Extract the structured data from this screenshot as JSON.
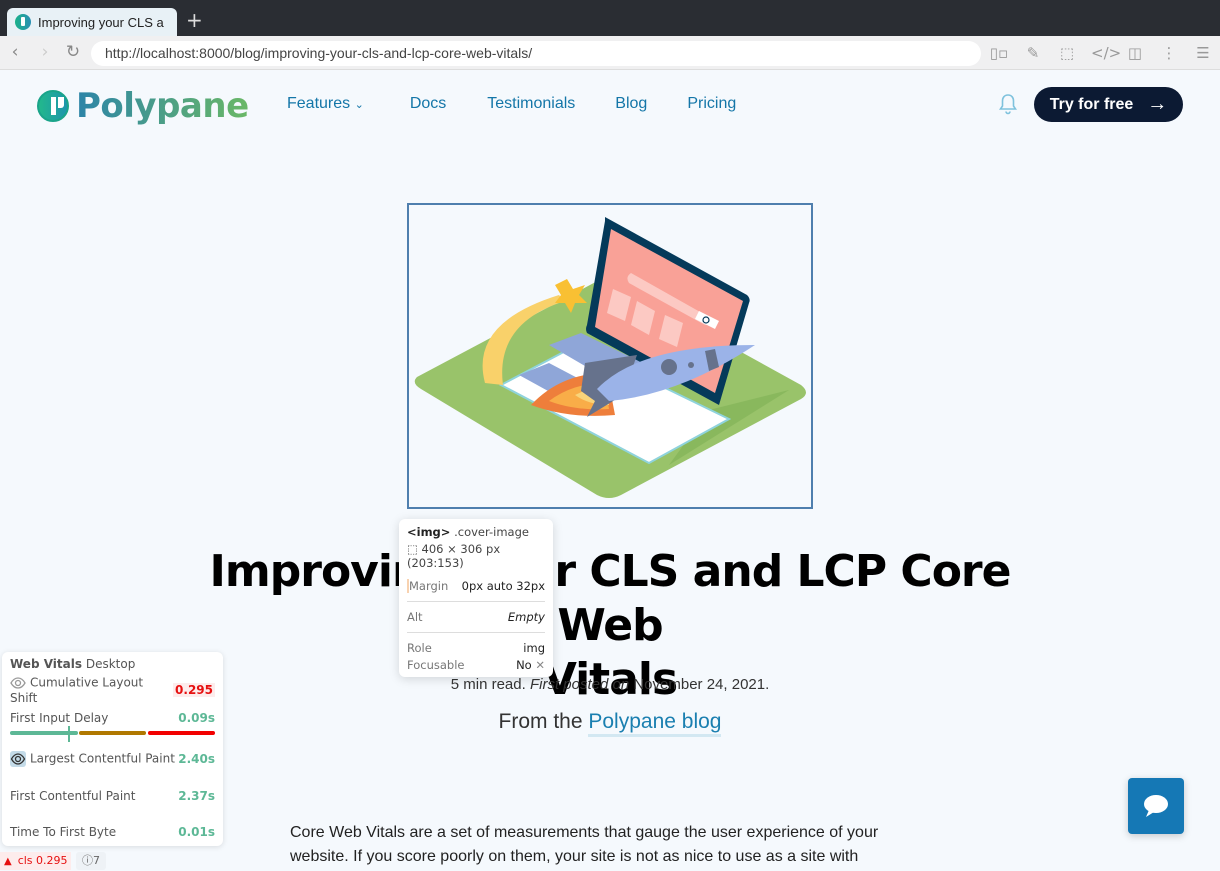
{
  "browser": {
    "tab_title": "Improving your CLS a",
    "new_tab": "+",
    "url": "http://localhost:8000/blog/improving-your-cls-and-lcp-core-web-vitals/"
  },
  "site": {
    "logo_text": "Polypane",
    "nav": [
      {
        "label": "Features",
        "has_dropdown": true
      },
      {
        "label": "Docs"
      },
      {
        "label": "Testimonials"
      },
      {
        "label": "Blog"
      },
      {
        "label": "Pricing"
      }
    ],
    "cta_label": "Try for free",
    "cta_arrow": "→",
    "colors": {
      "brand_dark": "#0c1a33",
      "link": "#1476a8",
      "chat": "#1578b5"
    }
  },
  "inspector": {
    "tag": "<img>",
    "class": ".cover-image",
    "dimensions": "406 × 306 px (203:153)",
    "margin_label": "Margin",
    "margin_value": "0px auto 32px",
    "alt_label": "Alt",
    "alt_value": "Empty",
    "role_label": "Role",
    "role_value": "img",
    "focusable_label": "Focusable",
    "focusable_value": "No"
  },
  "article": {
    "title": "Improving your CLS and LCP Core Web Vitals",
    "title_line1_a": "Improving",
    "title_line1_b": "CLS and LCP Core Web",
    "title_line2": "Vitals",
    "read_time": "5 min read.",
    "posted_prefix": "First posted on",
    "posted_date": "November 24, 2021.",
    "from_prefix": "From the",
    "from_link": "Polypane blog",
    "body": "Core Web Vitals are a set of measurements that gauge the user experience of your website. If you score poorly on them, your site is not as nice to use as a site with"
  },
  "web_vitals": {
    "title_bold": "Web Vitals",
    "title_rest": "Desktop",
    "metrics": [
      {
        "label": "Cumulative Layout Shift",
        "value": "0.295",
        "status": "bad"
      },
      {
        "label": "First Input Delay",
        "value": "0.09s",
        "status": "good"
      },
      {
        "label": "Largest Contentful Paint",
        "value": "2.40s",
        "status": "good"
      },
      {
        "label": "First Contentful Paint",
        "value": "2.37s",
        "status": "good"
      },
      {
        "label": "Time To First Byte",
        "value": "0.01s",
        "status": "good"
      }
    ],
    "cls_badge": "cls 0.295",
    "info_count": "7"
  }
}
